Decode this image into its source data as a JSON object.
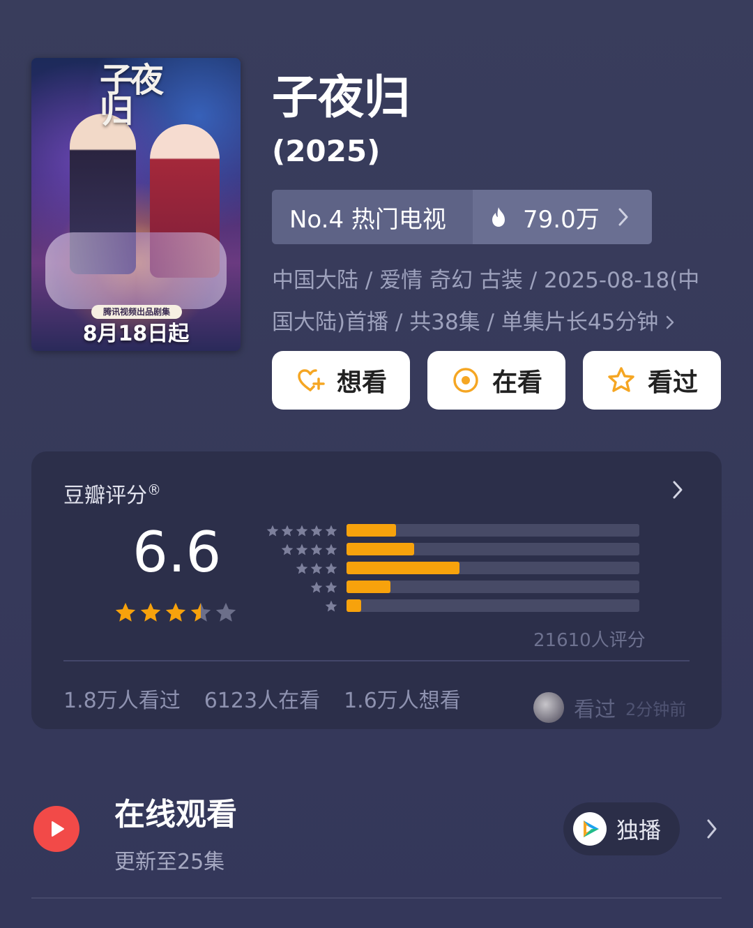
{
  "poster": {
    "title_art": "子夜归",
    "tag": "腾讯视频出品剧集",
    "date": "8月18日起"
  },
  "movie": {
    "title": "子夜归",
    "year": "(2025)"
  },
  "rank": {
    "label": "No.4 热门电视",
    "heat": "79.0万"
  },
  "meta": {
    "line": "中国大陆 / 爱情 奇幻 古装 / 2025-08-18(中国大陆)首播 / 共38集 / 单集片长45分钟"
  },
  "actions": [
    {
      "label": "想看",
      "icon": "heart-plus-icon"
    },
    {
      "label": "在看",
      "icon": "target-icon"
    },
    {
      "label": "看过",
      "icon": "star-outline-icon"
    }
  ],
  "rating": {
    "label": "豆瓣评分",
    "registered": "®",
    "score": "6.6",
    "stars": 3.5,
    "distribution": [
      {
        "stars": 5,
        "fraction": 0.17
      },
      {
        "stars": 4,
        "fraction": 0.23
      },
      {
        "stars": 3,
        "fraction": 0.385
      },
      {
        "stars": 2,
        "fraction": 0.15
      },
      {
        "stars": 1,
        "fraction": 0.05
      }
    ],
    "count": "21610人评分",
    "stats": [
      "1.8万人看过",
      "6123人在看",
      "1.6万人想看"
    ],
    "recent": {
      "action": "看过",
      "time": "2分钟前"
    }
  },
  "online": {
    "title": "在线观看",
    "subtitle": "更新至25集",
    "badge": "独播"
  },
  "colors": {
    "accent_orange": "#f7a20c",
    "play_red": "#f24a48",
    "background": "#393d5c"
  }
}
